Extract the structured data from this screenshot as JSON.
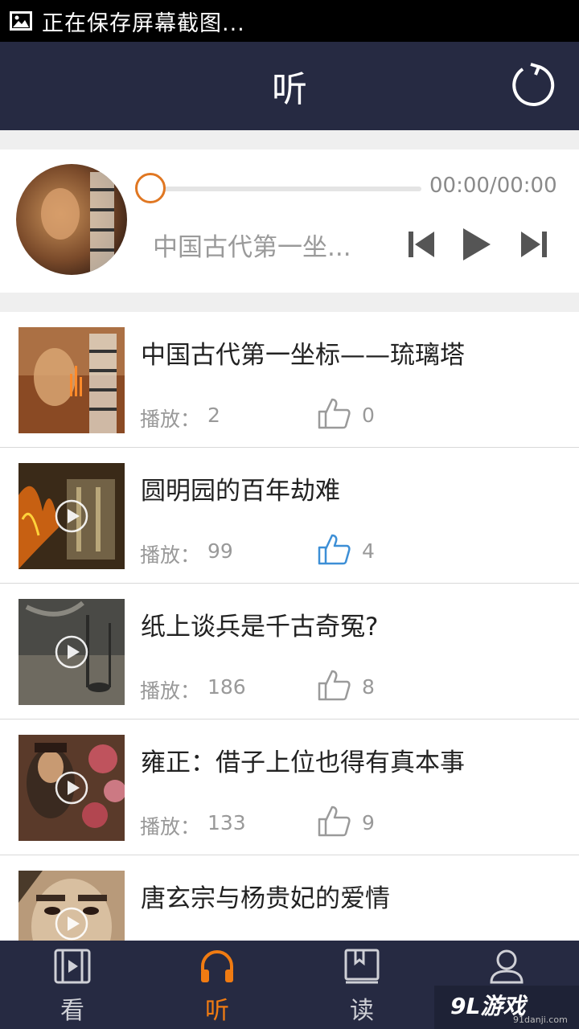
{
  "status_bar": {
    "text": "正在保存屏幕截图..."
  },
  "header": {
    "title": "听"
  },
  "player": {
    "time": "00:00/00:00",
    "track_title": "中国古代第一坐...",
    "progress": 0
  },
  "list": {
    "play_label": "播放：",
    "items": [
      {
        "title": "中国古代第一坐标——琉璃塔",
        "plays": "2",
        "likes": "0",
        "liked": false
      },
      {
        "title": "圆明园的百年劫难",
        "plays": "99",
        "likes": "4",
        "liked": true
      },
      {
        "title": "纸上谈兵是千古奇冤?",
        "plays": "186",
        "likes": "8",
        "liked": false
      },
      {
        "title": "雍正：借子上位也得有真本事",
        "plays": "133",
        "likes": "9",
        "liked": false
      },
      {
        "title": "唐玄宗与杨贵妃的爱情",
        "plays": "",
        "likes": "",
        "liked": false
      }
    ]
  },
  "tabs": [
    {
      "label": "看",
      "icon": "film-icon",
      "active": false
    },
    {
      "label": "听",
      "icon": "headphones-icon",
      "active": true
    },
    {
      "label": "读",
      "icon": "book-icon",
      "active": false
    },
    {
      "label": "我",
      "icon": "user-icon",
      "active": false
    }
  ],
  "watermark": {
    "logo": "9L游戏",
    "url": "91danji.com"
  },
  "colors": {
    "accent": "#f07b12",
    "header_bg": "#262a42",
    "like_active": "#3d8fd6"
  }
}
